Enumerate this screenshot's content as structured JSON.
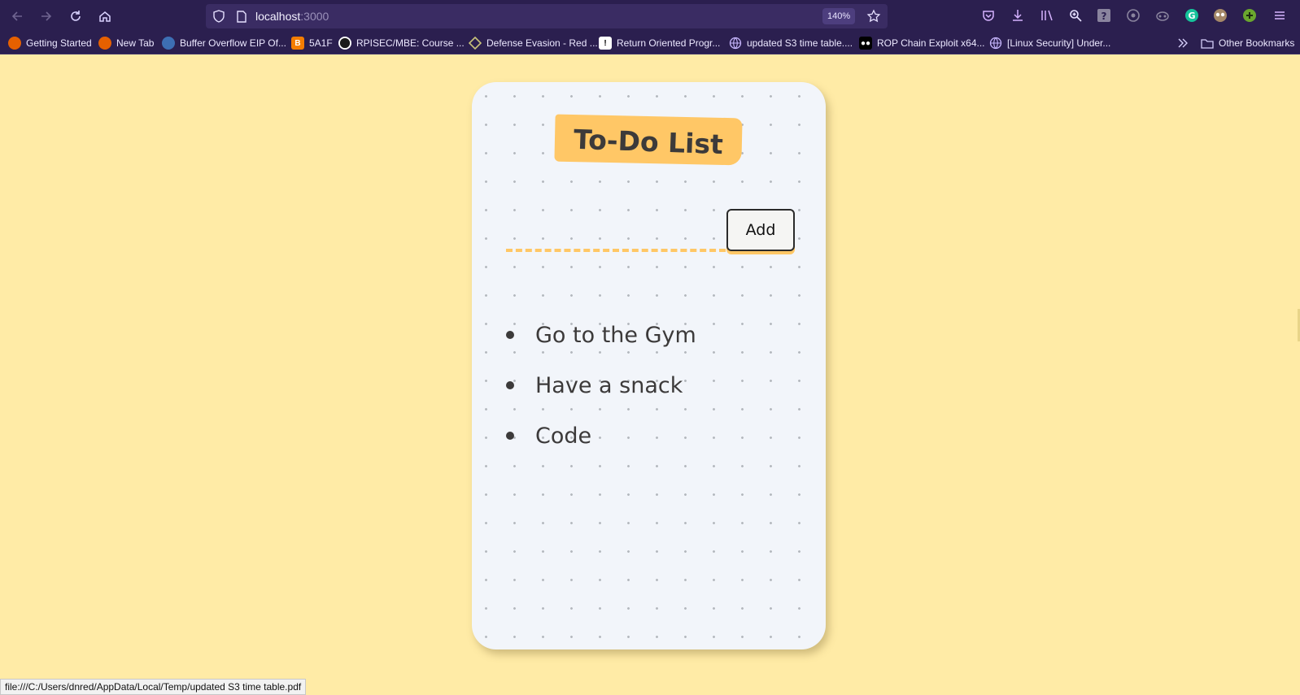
{
  "browser": {
    "url_host": "localhost",
    "url_port": ":3000",
    "zoom": "140%",
    "toolbar_icons": [
      "back-icon",
      "forward-icon",
      "reload-icon",
      "home-icon",
      "pocket-icon",
      "download-icon",
      "library-icon",
      "zoom-icon",
      "help-icon",
      "extension-icon",
      "extension-icon",
      "grammarly-icon",
      "extension-icon",
      "extension-icon",
      "menu-icon"
    ],
    "bookmarks": [
      {
        "label": "Getting Started",
        "color": "#e66000"
      },
      {
        "label": "New Tab",
        "color": "#e66000"
      },
      {
        "label": "Buffer Overflow EIP Of...",
        "color": "#3d6fb4"
      },
      {
        "label": "5A1F",
        "color": "#f57d00"
      },
      {
        "label": "RPISEC/MBE: Course ...",
        "color": "#ffffff"
      },
      {
        "label": "Defense Evasion - Red ...",
        "color": "#c9c37a"
      },
      {
        "label": "Return Oriented Progr...",
        "color": "#ffffff"
      },
      {
        "label": "updated S3 time table....",
        "color": "#c9b8ff"
      },
      {
        "label": "ROP Chain Exploit x64...",
        "color": "#000000"
      },
      {
        "label": "[Linux Security] Under...",
        "color": "#c9b8ff"
      }
    ],
    "other_bookmarks": "Other Bookmarks",
    "status_text": "file:///C:/Users/dnred/AppData/Local/Temp/updated S3 time table.pdf"
  },
  "app": {
    "title": "To-Do List",
    "input_value": "",
    "add_label": "Add",
    "items": [
      "Go to the Gym",
      "Have a snack",
      "Code"
    ],
    "colors": {
      "page_bg": "#ffeba6",
      "card_bg": "#f2f5fa",
      "accent": "#ffc766",
      "text": "#3c3a3a"
    }
  }
}
